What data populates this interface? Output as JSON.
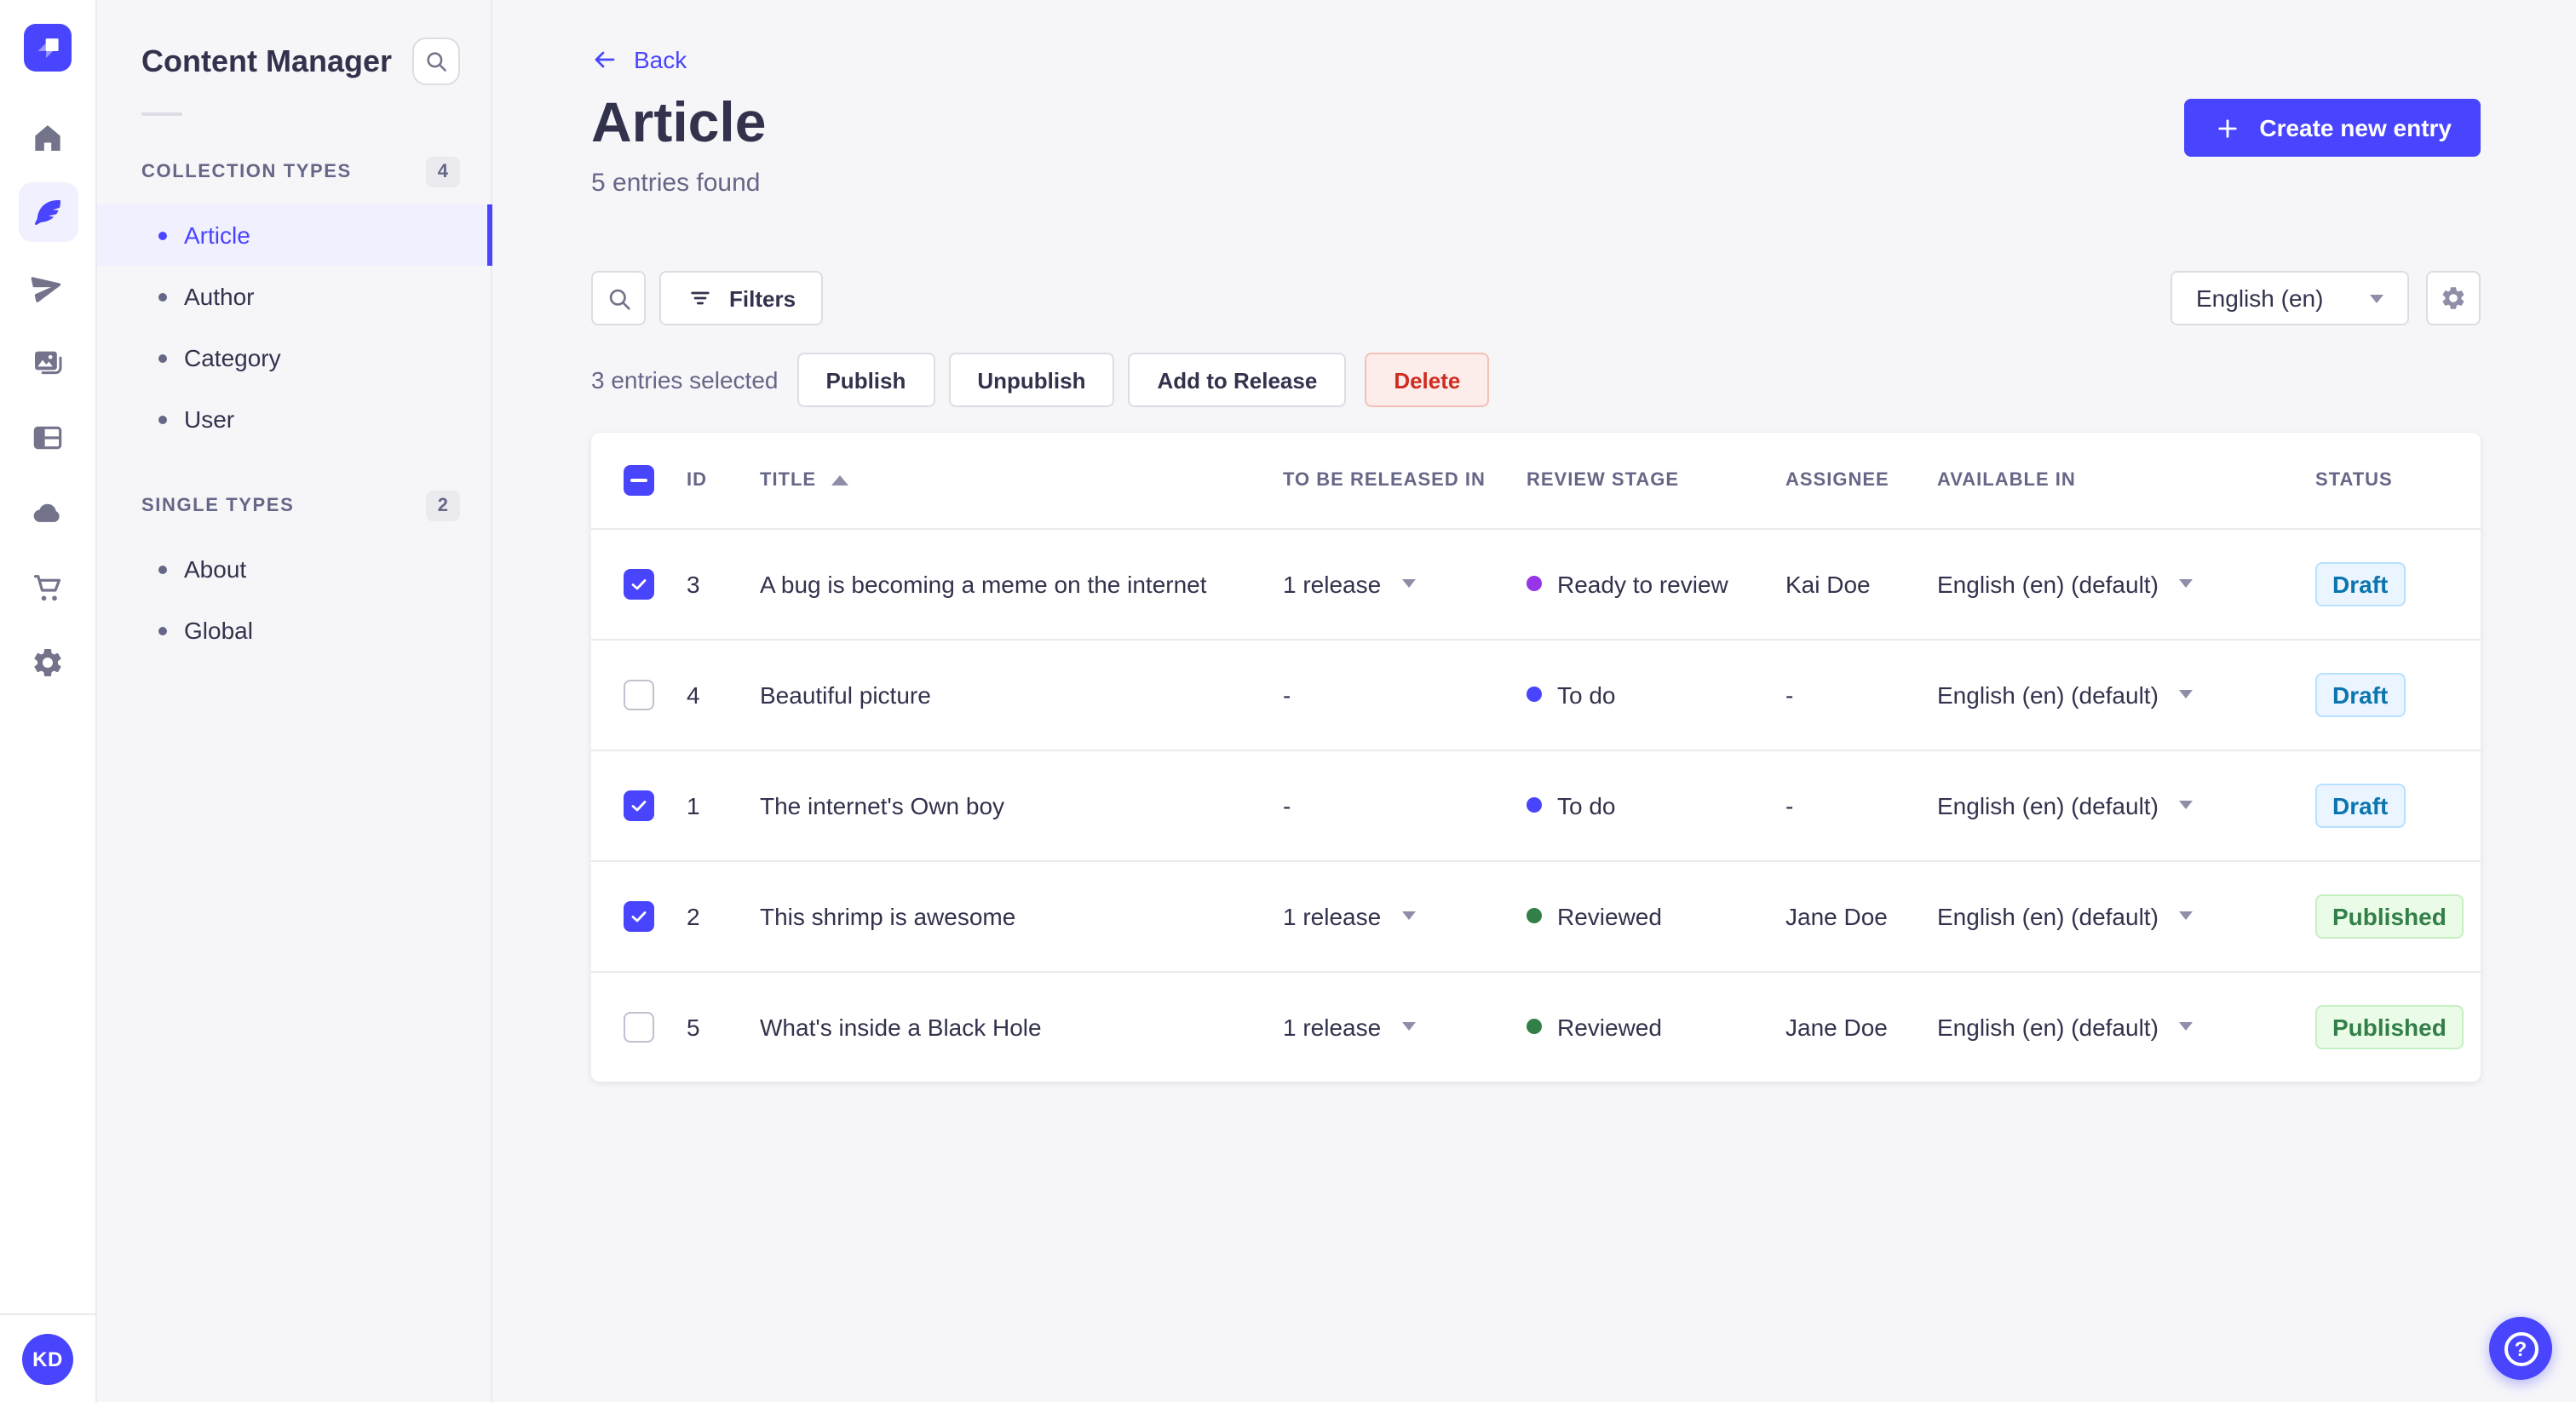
{
  "colors": {
    "primary": "#4945ff",
    "primary_light_bg": "#f0f0ff",
    "app_bg": "#f6f6f9",
    "surface": "#ffffff",
    "border": "#dcdce4",
    "border_light": "#eaeaef",
    "text": "#32324d",
    "text_muted": "#666687",
    "draft_bg": "#eaf5ff",
    "draft_border": "#b8e1ff",
    "draft_text": "#0c75af",
    "published_bg": "#eafbe7",
    "published_border": "#c6f0c2",
    "published_text": "#328048",
    "delete_bg": "#fcecea",
    "delete_border": "#f5c0b8",
    "delete_text": "#d02b20",
    "stage_todo": "#4945ff",
    "stage_ready_to_review": "#9736e8",
    "stage_reviewed": "#328048"
  },
  "icon_rail": {
    "logo_icon": "strapi-logo",
    "items": [
      {
        "icon": "home-icon",
        "active": false
      },
      {
        "icon": "content-manager-icon",
        "active": true
      },
      {
        "icon": "releases-icon",
        "active": false
      },
      {
        "icon": "media-library-icon",
        "active": false
      },
      {
        "icon": "content-type-builder-icon",
        "active": false
      },
      {
        "icon": "deploy-icon",
        "active": false
      },
      {
        "icon": "marketplace-icon",
        "active": false
      },
      {
        "icon": "settings-icon",
        "active": false
      }
    ],
    "avatar_initials": "KD"
  },
  "subnav": {
    "title": "Content Manager",
    "sections": [
      {
        "label": "COLLECTION TYPES",
        "count": "4",
        "items": [
          {
            "label": "Article",
            "active": true
          },
          {
            "label": "Author",
            "active": false
          },
          {
            "label": "Category",
            "active": false
          },
          {
            "label": "User",
            "active": false
          }
        ]
      },
      {
        "label": "SINGLE TYPES",
        "count": "2",
        "items": [
          {
            "label": "About",
            "active": false
          },
          {
            "label": "Global",
            "active": false
          }
        ]
      }
    ]
  },
  "header": {
    "back_label": "Back",
    "title": "Article",
    "subtitle": "5 entries found",
    "create_button_label": "Create new entry"
  },
  "toolbar": {
    "filters_label": "Filters",
    "locale_value": "English (en)"
  },
  "selection": {
    "label": "3 entries selected",
    "publish_label": "Publish",
    "unpublish_label": "Unpublish",
    "add_to_release_label": "Add to Release",
    "delete_label": "Delete"
  },
  "table": {
    "headers": {
      "id": "ID",
      "title": "TITLE",
      "released": "TO BE RELEASED IN",
      "review": "REVIEW STAGE",
      "assignee": "ASSIGNEE",
      "available": "AVAILABLE IN",
      "status": "STATUS"
    },
    "rows": [
      {
        "checked": true,
        "id": "3",
        "title": "A bug is becoming a meme on the internet",
        "released": "1 release",
        "stage": "Ready to review",
        "stage_color": "#9736e8",
        "assignee": "Kai Doe",
        "locale": "English (en) (default)",
        "status": "Draft"
      },
      {
        "checked": false,
        "id": "4",
        "title": "Beautiful picture",
        "released": "-",
        "stage": "To do",
        "stage_color": "#4945ff",
        "assignee": "-",
        "locale": "English (en) (default)",
        "status": "Draft"
      },
      {
        "checked": true,
        "id": "1",
        "title": "The internet's Own boy",
        "released": "-",
        "stage": "To do",
        "stage_color": "#4945ff",
        "assignee": "-",
        "locale": "English (en) (default)",
        "status": "Draft"
      },
      {
        "checked": true,
        "id": "2",
        "title": "This shrimp is awesome",
        "released": "1 release",
        "stage": "Reviewed",
        "stage_color": "#328048",
        "assignee": "Jane Doe",
        "locale": "English (en) (default)",
        "status": "Published"
      },
      {
        "checked": false,
        "id": "5",
        "title": "What's inside a Black Hole",
        "released": "1 release",
        "stage": "Reviewed",
        "stage_color": "#328048",
        "assignee": "Jane Doe",
        "locale": "English (en) (default)",
        "status": "Published"
      }
    ]
  }
}
